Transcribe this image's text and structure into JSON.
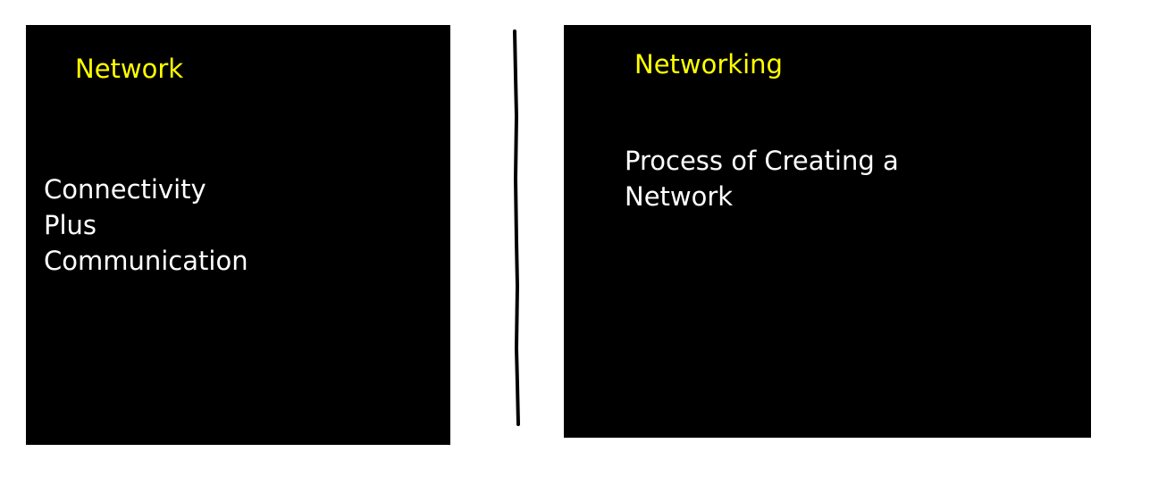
{
  "colors": {
    "background": "#ffffff",
    "panel": "#000000",
    "title": "#ffff00",
    "body": "#ffffff",
    "divider": "#000000"
  },
  "left_panel": {
    "title": "Network",
    "lines": [
      "Connectivity",
      "Plus",
      "Communication"
    ]
  },
  "right_panel": {
    "title": "Networking",
    "lines": [
      "Process of Creating a",
      "Network"
    ]
  }
}
